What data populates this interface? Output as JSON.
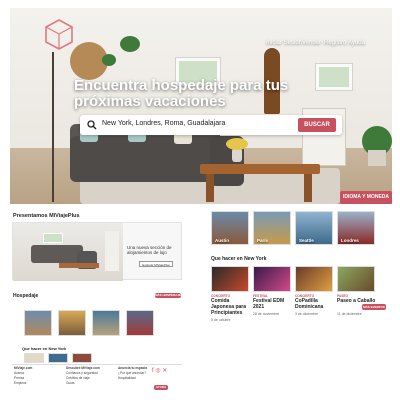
{
  "nav": {
    "items": [
      "Iniciar Sesión",
      "Vender",
      "Registro",
      "Ayuda"
    ]
  },
  "hero": {
    "headline": "Encuentra hospedaje para tus próximas vacaciones",
    "search_value": "New York, Londres, Roma, Guadalajara",
    "search_button": "BUSCAR",
    "lang_button": "IDIOMA Y MONEDA"
  },
  "promo": {
    "title": "Presentamos MiViajePlus",
    "text": "Una nueva sección de alojamientos de lujo",
    "button": "Explorar MiViajePlus"
  },
  "hospedaje": {
    "title": "Hospedaje",
    "more_button": "MÁS HOSPEDAJE"
  },
  "events_left": {
    "title": "Que hacer en New York"
  },
  "footer": {
    "col1": [
      "MiViaje.com",
      "Acerca",
      "Prensa",
      "Empleos",
      "Blog"
    ],
    "col2": [
      "Descubre MiViaje.com",
      "Confianza y seguridad",
      "Créditos de viaje",
      "Guías",
      "Viajes de negocios"
    ],
    "col3": [
      "Anuncia tu espacio",
      "¿Por qué anunciar?",
      "Hospitalidad",
      "Políticas"
    ],
    "contact_button": "AYUDA"
  },
  "destinations": {
    "items": [
      {
        "label": "Austin",
        "color": "#8a5a3a"
      },
      {
        "label": "París",
        "color": "#c79a4a"
      },
      {
        "label": "Seattle",
        "color": "#3e6a8a"
      },
      {
        "label": "Londres",
        "color": "#6a3a3a"
      }
    ]
  },
  "events": {
    "title": "Que hacer en New York",
    "items": [
      {
        "tag": "CONCIERTO",
        "title": "Comida Japonesa para Principiantes",
        "date": "5 de octubre"
      },
      {
        "tag": "FESTIVAL",
        "title": "Festival EDM 2021",
        "date": "28 de noviembre"
      },
      {
        "tag": "CONCIERTO",
        "title": "CoPadilla Dominicana",
        "date": "3 de diciembre"
      },
      {
        "tag": "PASEO",
        "title": "Paseo a Caballo",
        "date": "11 de diciembre"
      }
    ],
    "more_button": "MÁS EVENTOS"
  },
  "colors": {
    "accent": "#c8515f"
  }
}
